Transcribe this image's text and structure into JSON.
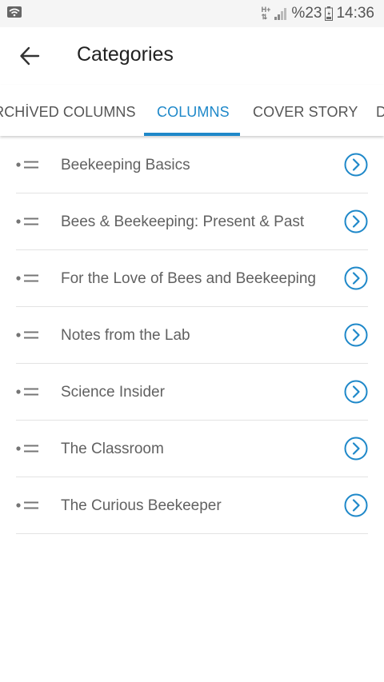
{
  "status_bar": {
    "network": "H+",
    "battery_percent": "%23",
    "time": "14:36"
  },
  "toolbar": {
    "title": "Categories",
    "back_icon": "arrow-left-icon"
  },
  "tabs": [
    {
      "label": "ARCHİVED COLUMNS",
      "active": false
    },
    {
      "label": "COLUMNS",
      "active": true
    },
    {
      "label": "COVER STORY",
      "active": false
    },
    {
      "label": "D",
      "active": false
    }
  ],
  "colors": {
    "accent": "#1e88c9",
    "text_primary": "#212121",
    "text_secondary": "#616161",
    "divider": "#e3e3e3"
  },
  "categories": [
    {
      "label": "Beekeeping Basics"
    },
    {
      "label": "Bees & Beekeeping: Present & Past"
    },
    {
      "label": "For the Love of Bees and Beekeeping"
    },
    {
      "label": "Notes from the Lab"
    },
    {
      "label": "Science Insider"
    },
    {
      "label": "The Classroom"
    },
    {
      "label": "The Curious Beekeeper"
    }
  ]
}
